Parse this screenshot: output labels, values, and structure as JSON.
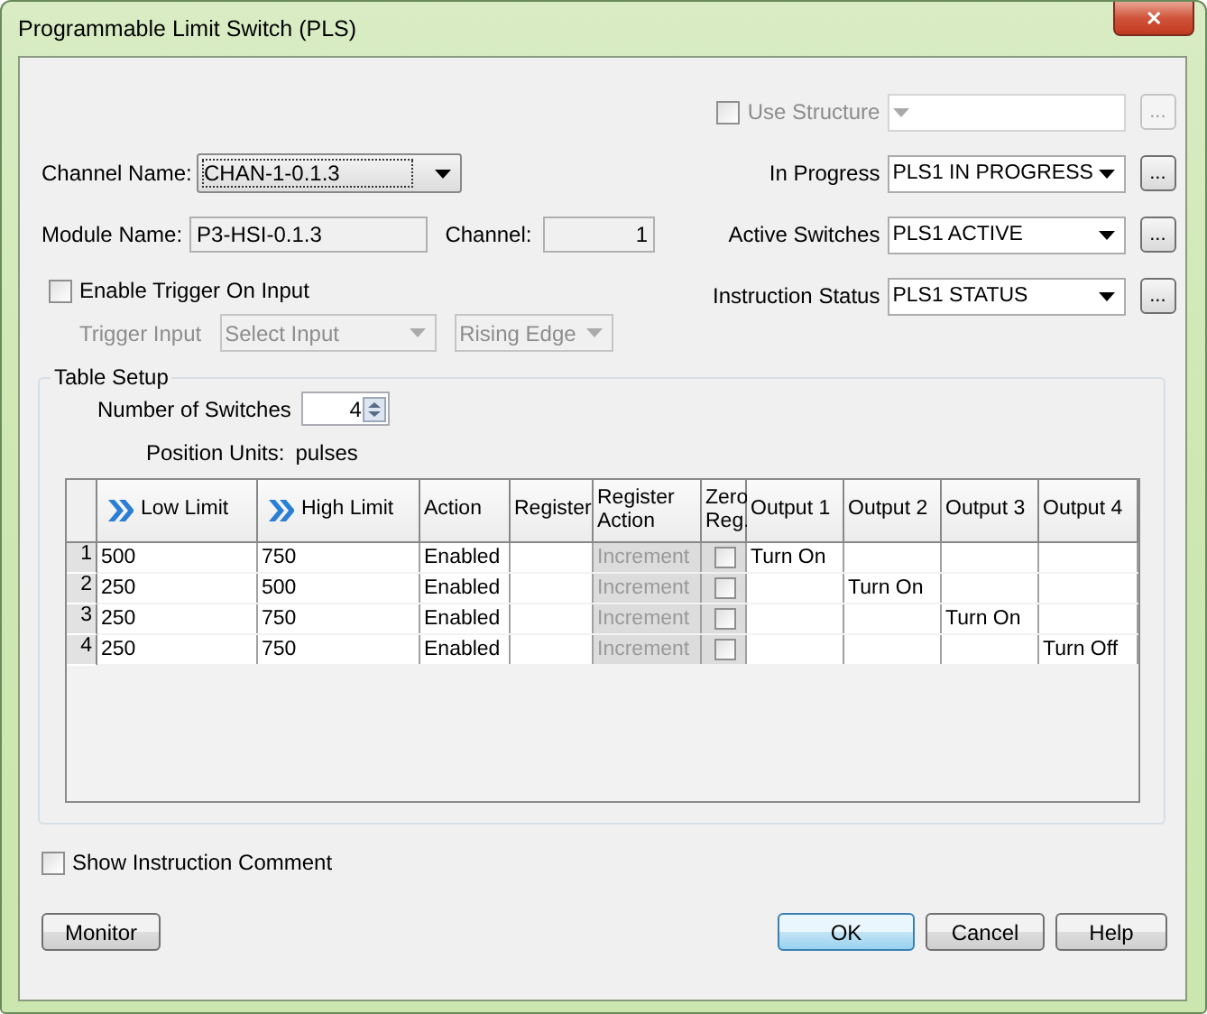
{
  "window": {
    "title": "Programmable Limit Switch (PLS)",
    "close": "✕"
  },
  "use_structure": {
    "label": "Use Structure",
    "checked": false,
    "disabled": true,
    "button": "..."
  },
  "channel_name": {
    "label": "Channel Name:",
    "value": "CHAN-1-0.1.3"
  },
  "module_name": {
    "label": "Module Name:",
    "value": "P3-HSI-0.1.3"
  },
  "channel": {
    "label": "Channel:",
    "value": "1"
  },
  "tags": [
    {
      "label": "In Progress",
      "value": "PLS1 IN PROGRESS",
      "button": "..."
    },
    {
      "label": "Active Switches",
      "value": "PLS1 ACTIVE",
      "button": "..."
    },
    {
      "label": "Instruction Status",
      "value": "PLS1 STATUS",
      "button": "..."
    }
  ],
  "enable_trigger": {
    "label": "Enable Trigger On Input",
    "checked": false
  },
  "trigger_input": {
    "label": "Trigger Input",
    "placeholder": "Select Input",
    "edge": "Rising Edge",
    "disabled": true
  },
  "table_setup": {
    "title": "Table Setup",
    "number_of_switches": {
      "label": "Number of Switches",
      "value": "4"
    },
    "position_units": {
      "label": "Position Units:",
      "value": "pulses"
    }
  },
  "table": {
    "columns": [
      {
        "label": "Low Limit",
        "kind": "limit"
      },
      {
        "label": "High Limit",
        "kind": "limit"
      },
      {
        "label": "Action",
        "kind": "text"
      },
      {
        "label": "Register",
        "kind": "text"
      },
      {
        "label": "Register Action",
        "kind": "text",
        "disabled": true
      },
      {
        "label": "Zero Reg.",
        "kind": "check",
        "disabled": true
      },
      {
        "label": "Output 1",
        "kind": "text"
      },
      {
        "label": "Output 2",
        "kind": "text"
      },
      {
        "label": "Output 3",
        "kind": "text"
      },
      {
        "label": "Output 4",
        "kind": "text"
      }
    ],
    "rows": [
      {
        "index": "1",
        "low_limit": "500",
        "high_limit": "750",
        "action": "Enabled",
        "register_action": "Increment",
        "zero_reg": false,
        "output_1": "Turn On"
      },
      {
        "index": "2",
        "low_limit": "250",
        "high_limit": "500",
        "action": "Enabled",
        "register_action": "Increment",
        "zero_reg": false,
        "output_2": "Turn On"
      },
      {
        "index": "3",
        "low_limit": "250",
        "high_limit": "750",
        "action": "Enabled",
        "register_action": "Increment",
        "zero_reg": false,
        "output_3": "Turn On"
      },
      {
        "index": "4",
        "low_limit": "250",
        "high_limit": "750",
        "action": "Enabled",
        "register_action": "Increment",
        "zero_reg": false,
        "output_4": "Turn Off"
      }
    ]
  },
  "show_comment": {
    "label": "Show Instruction Comment",
    "checked": false
  },
  "buttons": [
    {
      "label": "Monitor",
      "default": false
    },
    {
      "label": "OK",
      "default": true
    },
    {
      "label": "Cancel",
      "default": false
    },
    {
      "label": "Help",
      "default": false
    }
  ]
}
